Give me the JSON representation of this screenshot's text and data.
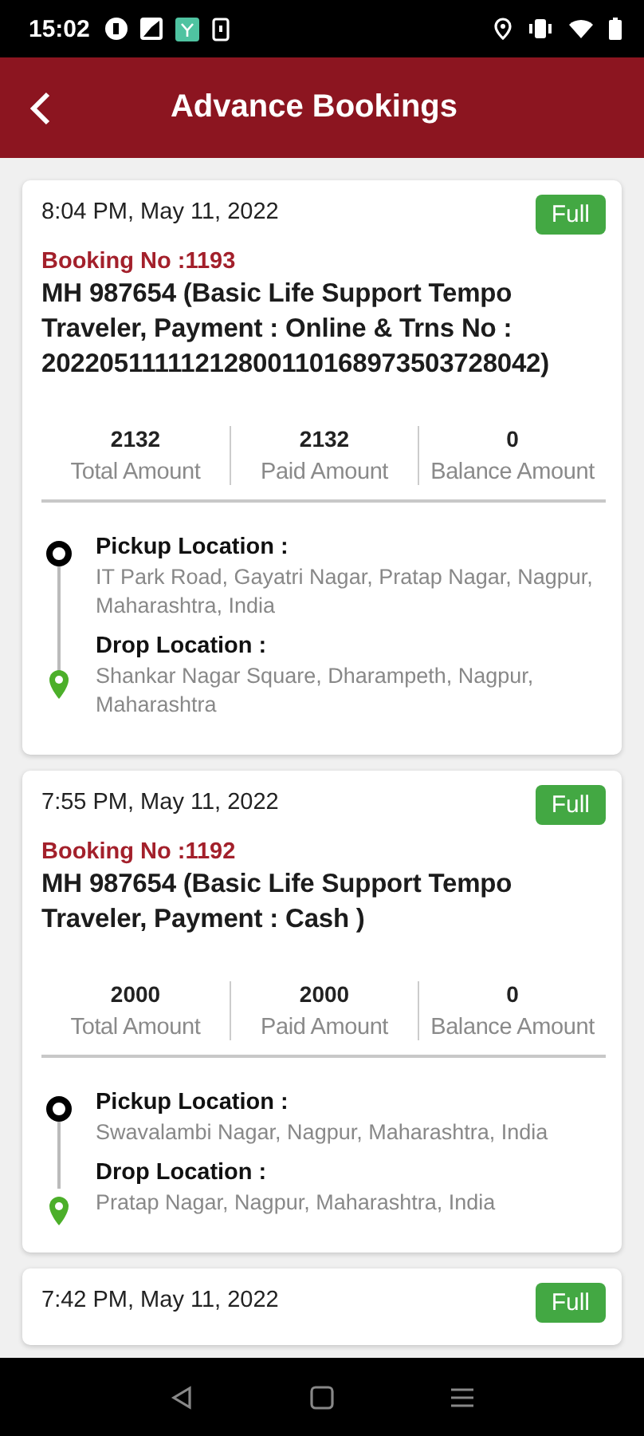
{
  "status_bar": {
    "time": "15:02"
  },
  "app_bar": {
    "title": "Advance Bookings"
  },
  "bookings": [
    {
      "datetime": "8:04 PM, May 11, 2022",
      "status": "Full",
      "booking_no": "Booking No :1193",
      "vehicle": "MH 987654 (Basic Life Support Tempo Traveler, Payment : Online & Trns No : 20220511111212800110168973503728042)",
      "amounts": [
        {
          "value": "2132",
          "label": "Total Amount"
        },
        {
          "value": "2132",
          "label": "Paid Amount"
        },
        {
          "value": "0",
          "label": "Balance Amount"
        }
      ],
      "pickup": {
        "label": "Pickup Location :",
        "address": "IT Park Road, Gayatri Nagar, Pratap Nagar, Nagpur, Maharashtra, India"
      },
      "drop": {
        "label": "Drop Location :",
        "address": "Shankar Nagar Square, Dharampeth, Nagpur, Maharashtra"
      }
    },
    {
      "datetime": "7:55 PM, May 11, 2022",
      "status": "Full",
      "booking_no": "Booking No :1192",
      "vehicle": "MH 987654 (Basic Life Support Tempo Traveler, Payment : Cash )",
      "amounts": [
        {
          "value": "2000",
          "label": "Total Amount"
        },
        {
          "value": "2000",
          "label": "Paid Amount"
        },
        {
          "value": "0",
          "label": "Balance Amount"
        }
      ],
      "pickup": {
        "label": "Pickup Location :",
        "address": "Swavalambi Nagar, Nagpur, Maharashtra, India"
      },
      "drop": {
        "label": "Drop Location :",
        "address": "Pratap Nagar, Nagpur, Maharashtra, India"
      }
    },
    {
      "datetime": "7:42 PM, May 11, 2022",
      "status": "Full"
    }
  ]
}
